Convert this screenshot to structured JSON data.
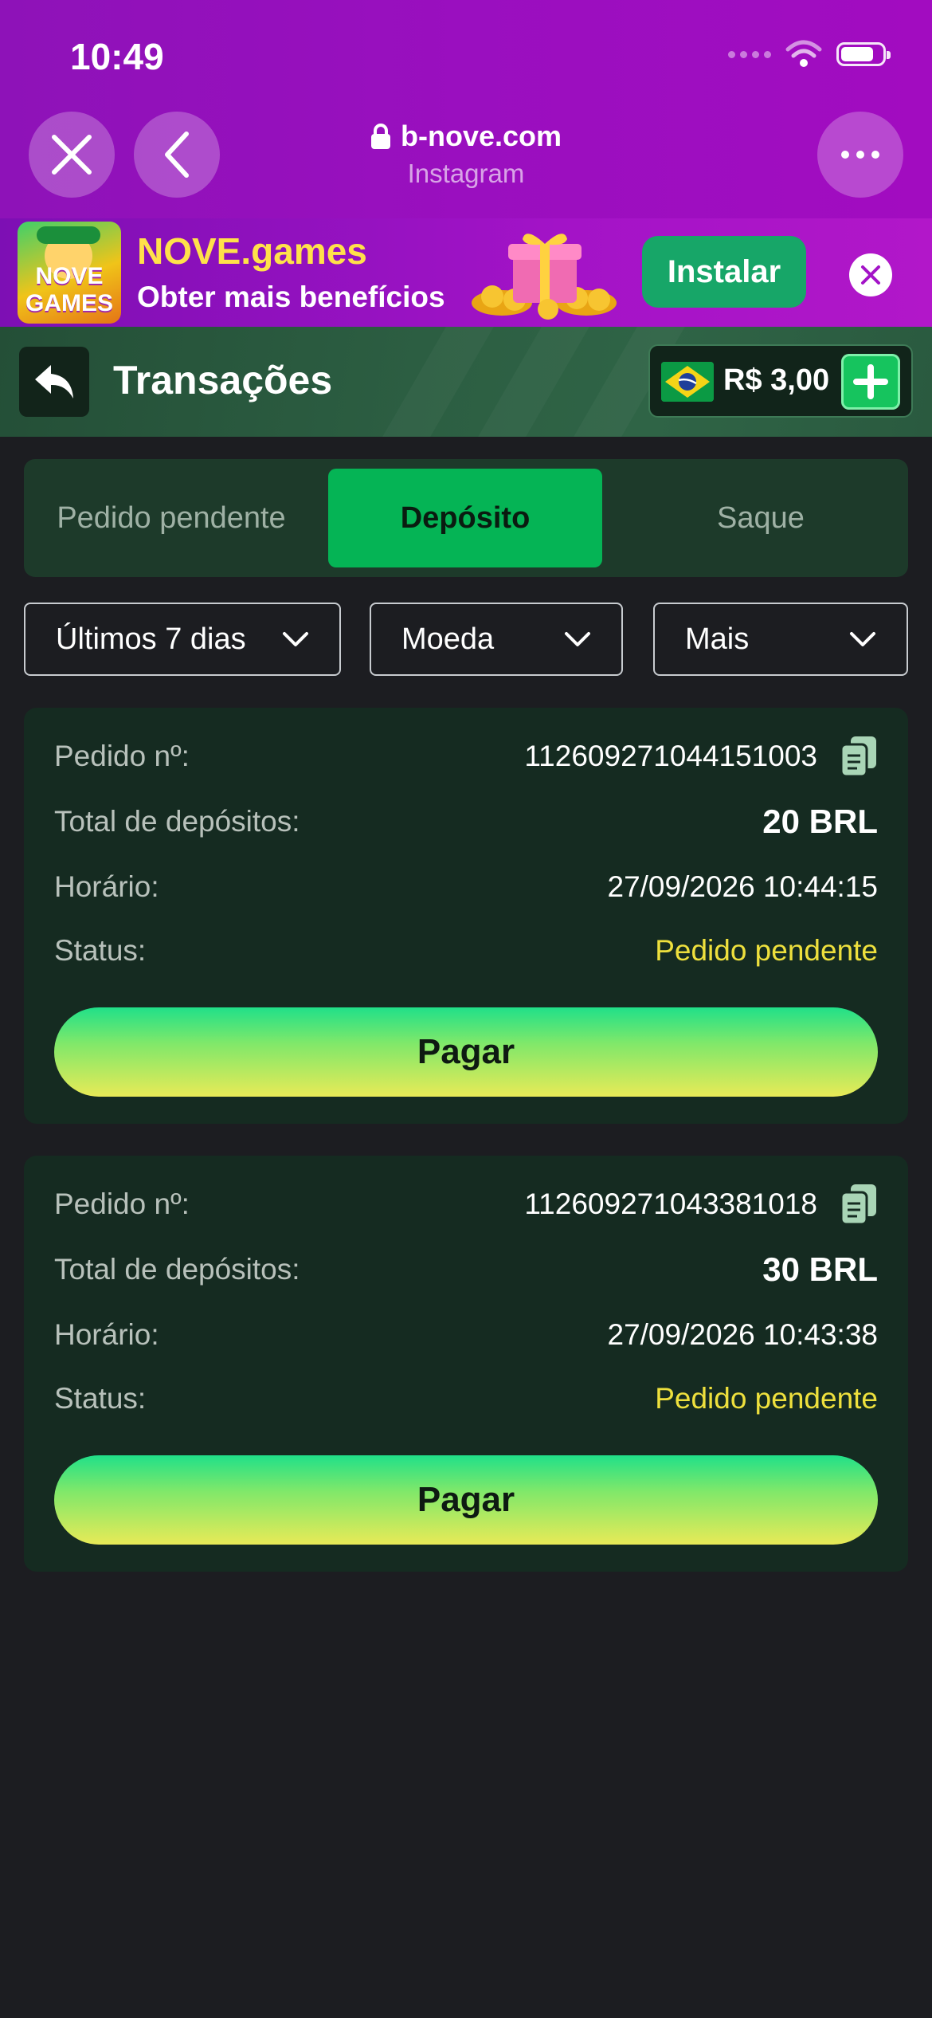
{
  "status_bar": {
    "time": "10:49"
  },
  "browser": {
    "domain": "b-nove.com",
    "source": "Instagram",
    "close_icon": "close-icon",
    "back_icon": "chevron-left-icon",
    "more_icon": "more-horizontal-icon"
  },
  "install_banner": {
    "app_icon_text": "NOVE GAMES",
    "title": "NOVE.games",
    "subtitle": "Obter mais benefícios",
    "install_label": "Instalar",
    "colors": {
      "install_button": "#17a668",
      "title": "#ffe14a"
    }
  },
  "header": {
    "title": "Transações",
    "balance": "R$ 3,00",
    "back_icon": "back-arrow-icon",
    "flag_icon": "brazil-flag-icon",
    "add_icon": "plus-icon"
  },
  "tabs": [
    {
      "label": "Pedido pendente",
      "active": false
    },
    {
      "label": "Depósito",
      "active": true
    },
    {
      "label": "Saque",
      "active": false
    }
  ],
  "filters": [
    {
      "label": "Últimos 7 dias"
    },
    {
      "label": "Moeda"
    },
    {
      "label": "Mais"
    }
  ],
  "labels": {
    "order_no": "Pedido nº:",
    "total": "Total de depósitos:",
    "time": "Horário:",
    "status": "Status:"
  },
  "transactions": [
    {
      "order_no": "112609271044151003",
      "total": "20 BRL",
      "time": "27/09/2026 10:44:15",
      "status": "Pedido pendente",
      "action": "Pagar"
    },
    {
      "order_no": "112609271043381018",
      "total": "30 BRL",
      "time": "27/09/2026 10:43:38",
      "status": "Pedido pendente",
      "action": "Pagar"
    }
  ],
  "theme": {
    "accent_green": "#05b455",
    "status_pending": "#eee03d",
    "card_bg": "#152b21",
    "page_bg": "#1c1d21"
  }
}
